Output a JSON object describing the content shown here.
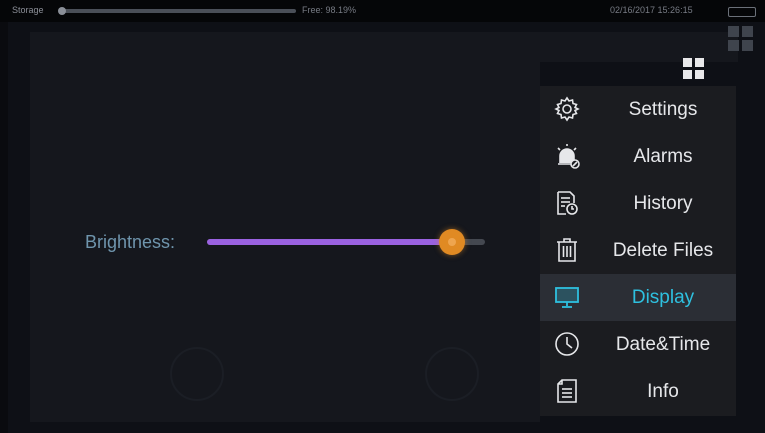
{
  "status_bar": {
    "storage_label": "Storage",
    "storage_used_fraction": 0.0,
    "free_label": "Free: 98.19%",
    "datetime": "02/16/2017 15:26:15"
  },
  "brightness": {
    "label": "Brightness:",
    "value_fraction": 0.88
  },
  "menu": {
    "items": [
      {
        "label": "Settings",
        "icon": "gear-icon"
      },
      {
        "label": "Alarms",
        "icon": "siren-icon"
      },
      {
        "label": "History",
        "icon": "history-icon"
      },
      {
        "label": "Delete Files",
        "icon": "trash-icon"
      },
      {
        "label": "Display",
        "icon": "monitor-icon",
        "active": true
      },
      {
        "label": "Date&Time",
        "icon": "clock-icon"
      },
      {
        "label": "Info",
        "icon": "document-icon"
      }
    ]
  },
  "colors": {
    "accent": "#2ec0df",
    "slider_fill": "#9a62e0",
    "slider_thumb": "#e08a23",
    "brightness_label": "#6f95ad"
  }
}
